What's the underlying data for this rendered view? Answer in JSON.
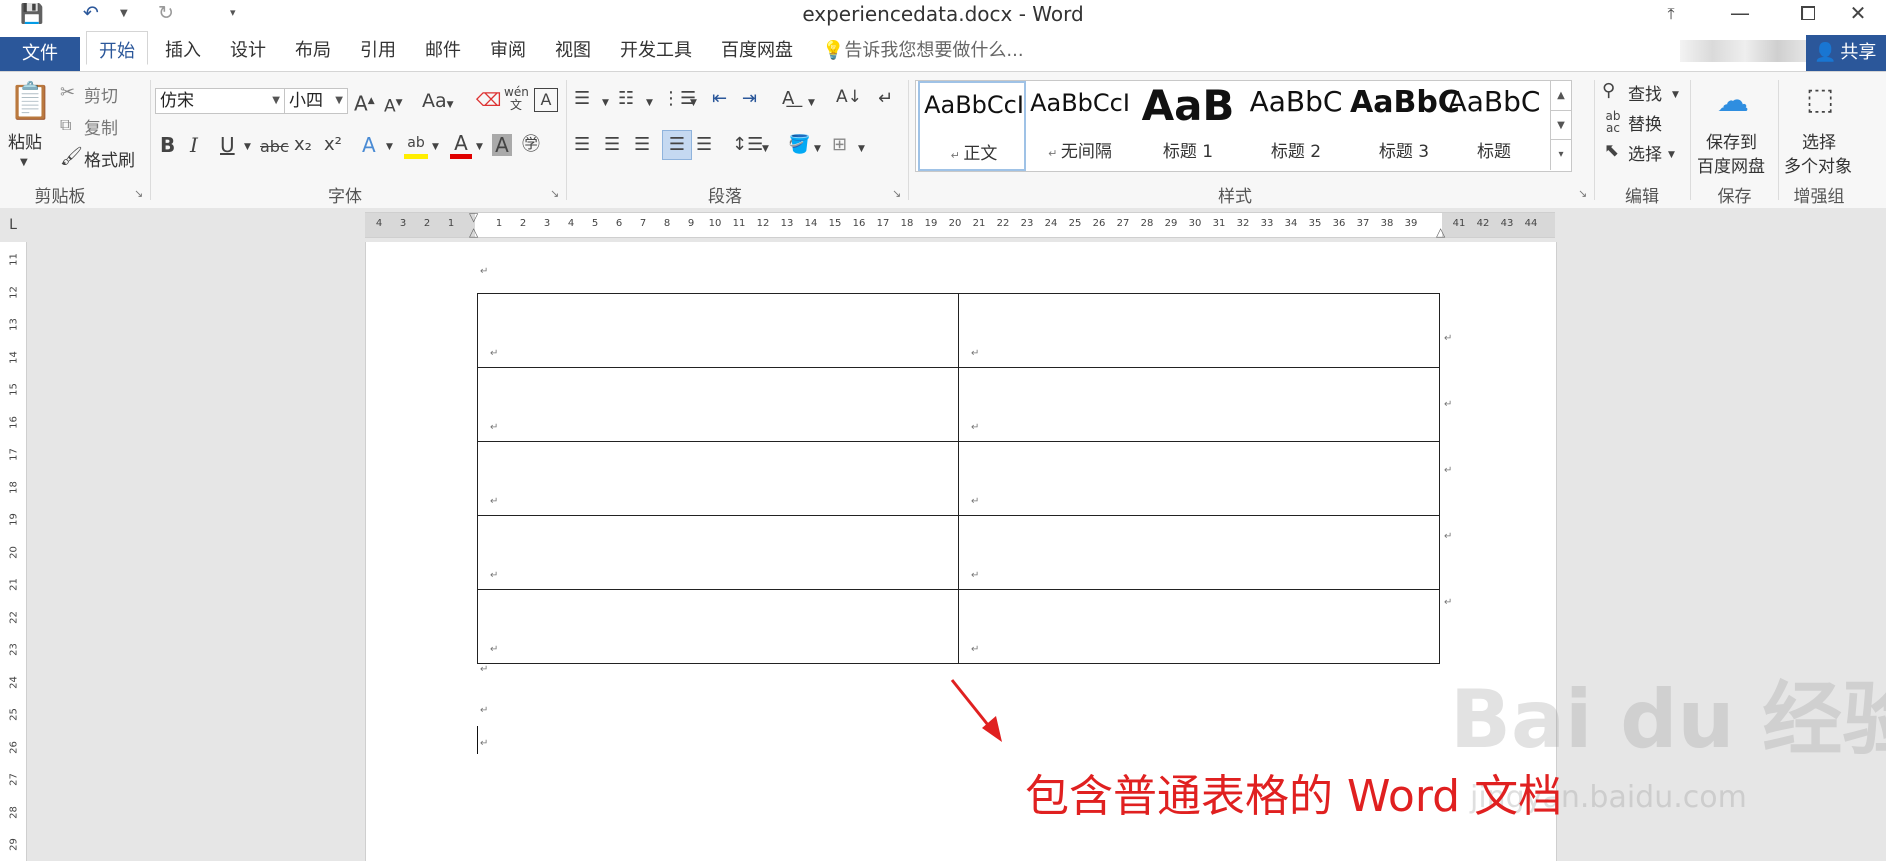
{
  "window": {
    "title": "experiencedata.docx - Word",
    "restore_icon": "⧉",
    "minimize_icon": "—",
    "maximize_icon": "⧠",
    "close_icon": "✕",
    "ribbon_display_icon": "⤒"
  },
  "tabs": {
    "file": "文件",
    "items": [
      "开始",
      "插入",
      "设计",
      "布局",
      "引用",
      "邮件",
      "审阅",
      "视图",
      "开发工具",
      "百度网盘"
    ],
    "tell_me": "告诉我您想要做什么...",
    "share": "共享"
  },
  "ribbon": {
    "clipboard": {
      "paste": "粘贴",
      "cut": "剪切",
      "copy": "复制",
      "format_painter": "格式刷",
      "label": "剪贴板"
    },
    "font": {
      "name": "仿宋",
      "size": "小四",
      "label": "字体",
      "change_case": "Aa",
      "bold": "B",
      "italic": "I",
      "underline": "U",
      "strike": "abc",
      "sub": "x₂",
      "sup": "x²"
    },
    "paragraph": {
      "label": "段落"
    },
    "styles": {
      "label": "样式",
      "items": [
        {
          "sample": "AaBbCcI",
          "name": "正文"
        },
        {
          "sample": "AaBbCcI",
          "name": "无间隔"
        },
        {
          "sample": "AaB",
          "name": "标题 1"
        },
        {
          "sample": "AaBbC",
          "name": "标题 2"
        },
        {
          "sample": "AaBbC",
          "name": "标题 3"
        },
        {
          "sample": "AaBbC",
          "name": "标题"
        }
      ]
    },
    "editing": {
      "find": "查找",
      "replace": "替换",
      "select": "选择",
      "label": "编辑"
    },
    "save": {
      "line1": "保存到",
      "line2": "百度网盘",
      "label": "保存"
    },
    "enhance": {
      "line1": "选择",
      "line2": "多个对象",
      "label": "增强组"
    }
  },
  "ruler": {
    "h_left": [
      "4",
      "3",
      "2",
      "1"
    ],
    "h_right": [
      "1",
      "2",
      "3",
      "4",
      "5",
      "6",
      "7",
      "8",
      "9",
      "10",
      "11",
      "12",
      "13",
      "14",
      "15",
      "16",
      "17",
      "18",
      "19",
      "20",
      "21",
      "22",
      "23",
      "24",
      "25",
      "26",
      "27",
      "28",
      "29",
      "30",
      "31",
      "32",
      "33",
      "34",
      "35",
      "36",
      "37",
      "38",
      "39",
      "41",
      "42",
      "43",
      "44"
    ],
    "v": [
      "11",
      "12",
      "13",
      "14",
      "15",
      "16",
      "17",
      "18",
      "19",
      "20",
      "21",
      "22",
      "23",
      "24",
      "25",
      "26",
      "27",
      "28",
      "29"
    ],
    "corner": "L"
  },
  "document": {
    "paragraph_mark": "↵",
    "table_rows": 5,
    "table_cols": 2
  },
  "annotation": {
    "text": "包含普通表格的 Word 文档",
    "color": "#e02020"
  },
  "watermark": {
    "main": "Bai du 经验",
    "sub": "jingyan.baidu.com"
  },
  "colors": {
    "accent": "#2b579a"
  }
}
